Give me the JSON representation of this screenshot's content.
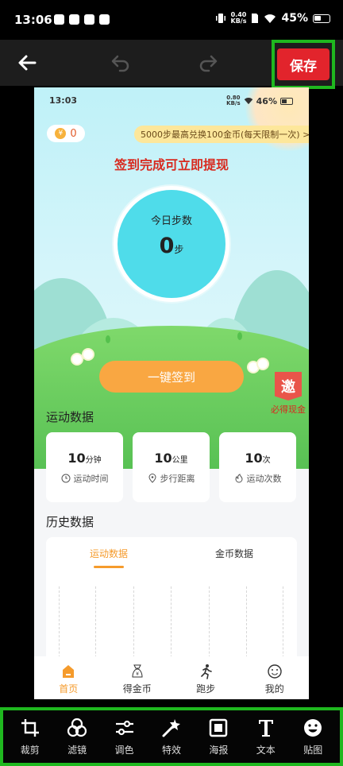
{
  "status_bar": {
    "time": "13:06",
    "net_speed_value": "0.40",
    "net_speed_unit": "KB/s",
    "battery": "45%"
  },
  "editor_top": {
    "save_label": "保存"
  },
  "canvas": {
    "status": {
      "time": "13:03",
      "net_speed_value": "0.80",
      "net_speed_unit": "KB/s",
      "battery": "46%"
    },
    "coin_count": "0",
    "exchange_banner": "5000步最高兑换100金币(每天限制一次) >",
    "headline": "签到完成可立即提现",
    "steps": {
      "title": "今日步数",
      "value": "0",
      "unit": "步"
    },
    "checkin_label": "一键签到",
    "invite": {
      "badge": "邀",
      "text": "必得现金"
    },
    "sport_title": "运动数据",
    "stats": [
      {
        "value": "10",
        "unit": "分钟",
        "label": "运动时间",
        "icon": "clock-icon"
      },
      {
        "value": "10",
        "unit": "公里",
        "label": "步行距离",
        "icon": "location-pin-icon"
      },
      {
        "value": "10",
        "unit": "次",
        "label": "运动次数",
        "icon": "flame-icon"
      }
    ],
    "history_title": "历史数据",
    "history_tabs": [
      "运动数据",
      "金币数据"
    ],
    "tabbar": [
      {
        "label": "首页",
        "icon": "home-icon",
        "active": true
      },
      {
        "label": "得金币",
        "icon": "coin-bag-icon",
        "active": false
      },
      {
        "label": "跑步",
        "icon": "runner-icon",
        "active": false
      },
      {
        "label": "我的",
        "icon": "smiley-icon",
        "active": false
      }
    ]
  },
  "tools": [
    {
      "label": "裁剪",
      "icon": "crop-icon"
    },
    {
      "label": "滤镜",
      "icon": "filter-icon"
    },
    {
      "label": "调色",
      "icon": "adjust-icon"
    },
    {
      "label": "特效",
      "icon": "magic-wand-icon"
    },
    {
      "label": "海报",
      "icon": "poster-icon"
    },
    {
      "label": "文本",
      "icon": "text-icon"
    },
    {
      "label": "贴图",
      "icon": "sticker-icon"
    }
  ],
  "colors": {
    "save_red": "#e2242c",
    "highlight_green": "#1fb81f",
    "accent_orange": "#f59b2c",
    "step_circle": "#4fdcea"
  }
}
